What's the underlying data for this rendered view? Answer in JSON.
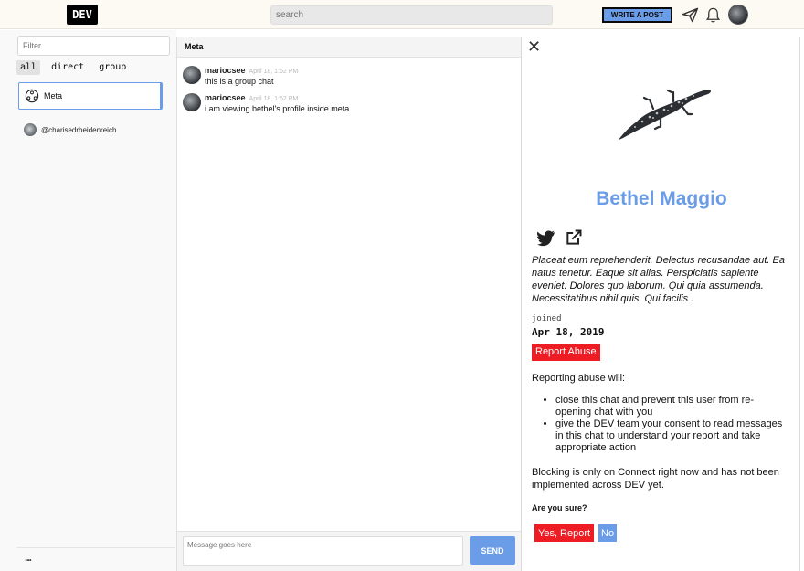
{
  "topbar": {
    "logo": "DEV",
    "search_placeholder": "search",
    "write_post": "WRITE A POST"
  },
  "sidebar": {
    "filter_placeholder": "Filter",
    "tabs": [
      "all",
      "direct",
      "group"
    ],
    "channels": [
      {
        "label": "Meta"
      },
      {
        "label": "@charisedrheidenreich"
      }
    ],
    "more": "..."
  },
  "chat": {
    "title": "Meta",
    "messages": [
      {
        "author": "mariocsee",
        "time": "April 18, 1:52 PM",
        "text": "this is a group chat"
      },
      {
        "author": "mariocsee",
        "time": "April 18, 1:52 PM",
        "text": "i am viewing bethel's profile inside meta"
      }
    ],
    "composer_placeholder": "Message goes here",
    "send_label": "SEND"
  },
  "profile": {
    "close": "✕",
    "name": "Bethel Maggio",
    "bio": "Placeat eum reprehenderit. Delectus recusandae aut. Ea natus tenetur. Eaque sit alias. Perspiciatis sapiente eveniet. Dolores quo laborum. Qui quia assumenda. Necessitatibus nihil quis. Qui facilis .",
    "joined_label": "joined",
    "joined_date": "Apr 18, 2019",
    "report_label": "Report Abuse",
    "reporting_intro": "Reporting abuse will:",
    "bullets": [
      "close this chat and prevent this user from re-opening chat with you",
      "give the DEV team your consent to read messages in this chat to understand your report and take appropriate action"
    ],
    "blocking_note": "Blocking is only on Connect right now and has not been implemented across DEV yet.",
    "confirm_question": "Are you sure?",
    "yes_label": "Yes, Report",
    "no_label": "No"
  },
  "colors": {
    "accent": "#6a9ce8",
    "danger": "#ee1d24"
  }
}
